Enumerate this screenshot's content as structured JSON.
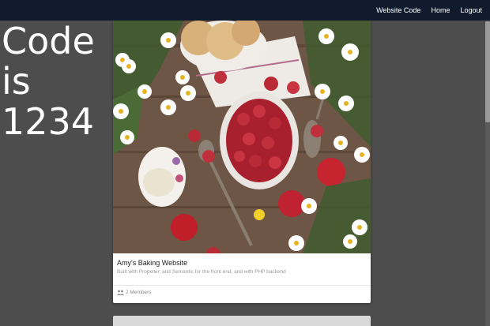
{
  "navbar": {
    "links": [
      "Website Code",
      "Home",
      "Logout"
    ]
  },
  "overlay": {
    "code_text": "Code\nis\n1234"
  },
  "card": {
    "title": "Amy's Baking Website",
    "description": "Built with Propeller, and Semantic for the front end, and with PHP backend",
    "members": "2 Members",
    "members_icon": "group-icon",
    "image_name": "raspberries-flowers-photo"
  },
  "colors": {
    "navbar_bg": "#101c2e",
    "page_bg": "#4d4d4d",
    "card_bg": "#ffffff"
  }
}
